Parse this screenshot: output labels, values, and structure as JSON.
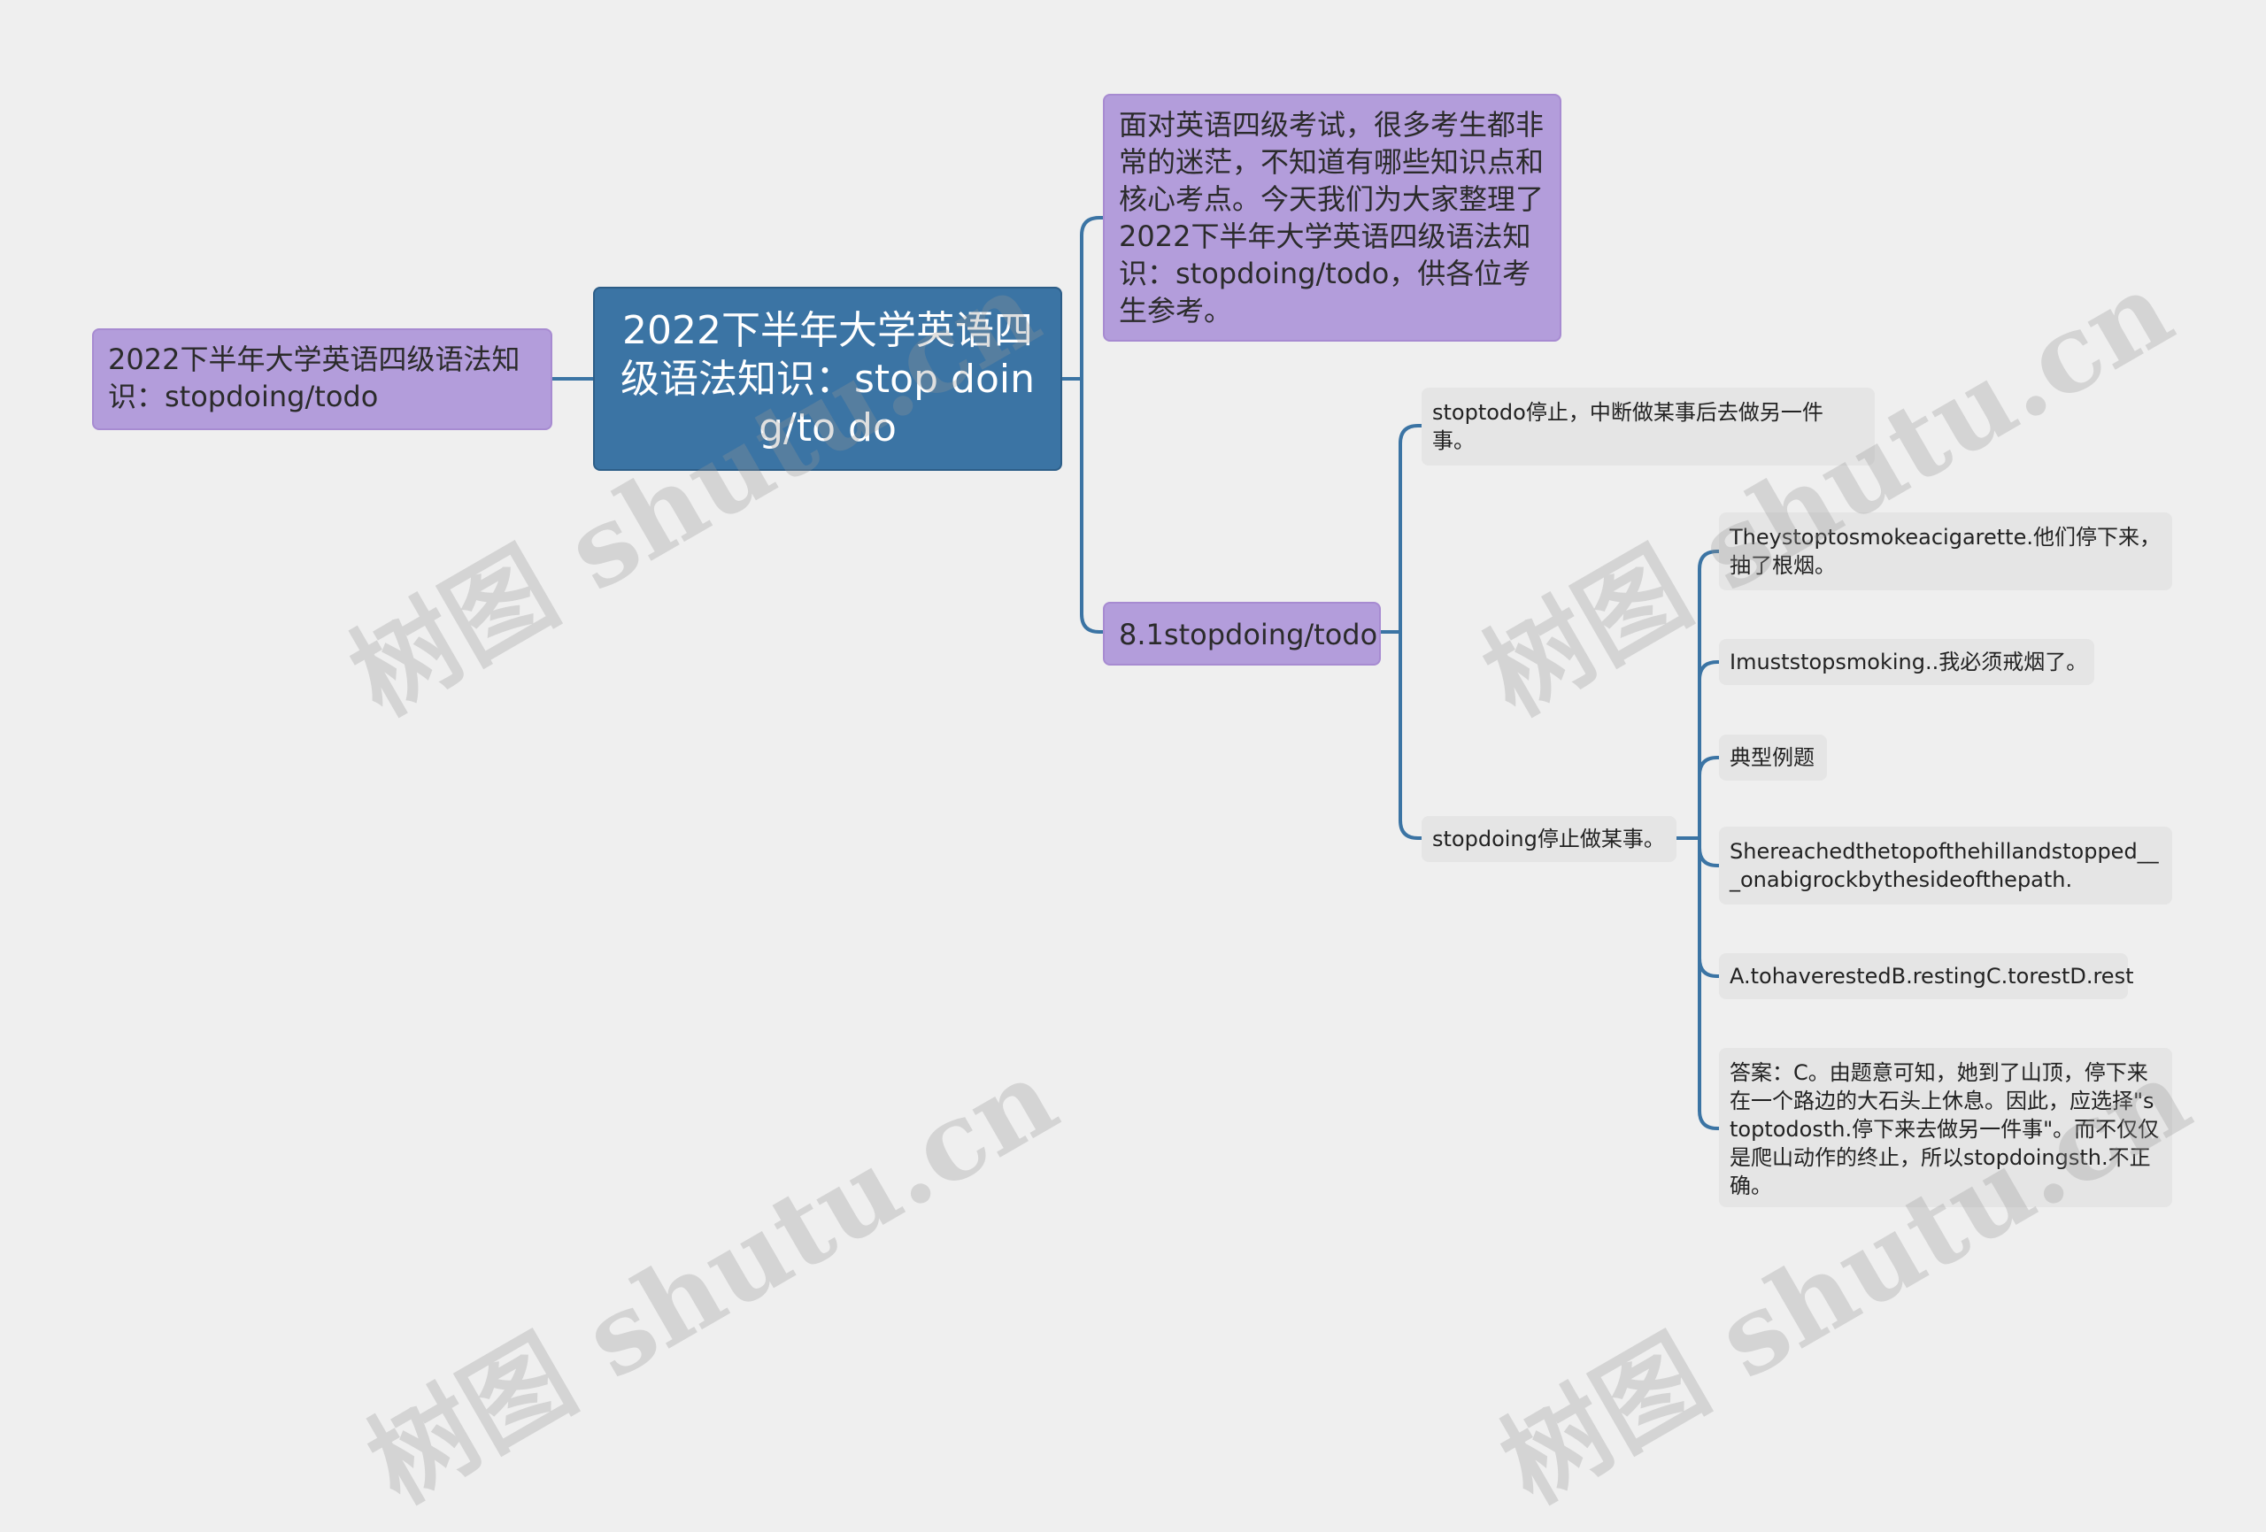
{
  "watermark": "树图 shutu.cn",
  "left_node": "2022下半年大学英语四级语法知识：stopdoing/todo",
  "root": "2022下半年大学英语四级语法知识：stop doing/to do",
  "intro": "面对英语四级考试，很多考生都非常的迷茫，不知道有哪些知识点和核心考点。今天我们为大家整理了2022下半年大学英语四级语法知识：stopdoing/todo，供各位考生参考。",
  "section": "8.1stopdoing/todo",
  "stoptodo": "stoptodo停止，中断做某事后去做另一件事。",
  "stopdoing": "stopdoing停止做某事。",
  "details": [
    "Theystoptosmokeacigarette.他们停下来，抽了根烟。",
    "Imuststopsmoking..我必须戒烟了。",
    "典型例题",
    "Shereachedthetopofthehillandstopped___onabigrockbythesideofthepath.",
    "A.tohaverestedB.restingC.torestD.rest",
    "答案：C。由题意可知，她到了山顶，停下来在一个路边的大石头上休息。因此，应选择\"stoptodosth.停下来去做另一件事\"。而不仅仅是爬山动作的终止，所以stopdoingsth.不正确。"
  ]
}
